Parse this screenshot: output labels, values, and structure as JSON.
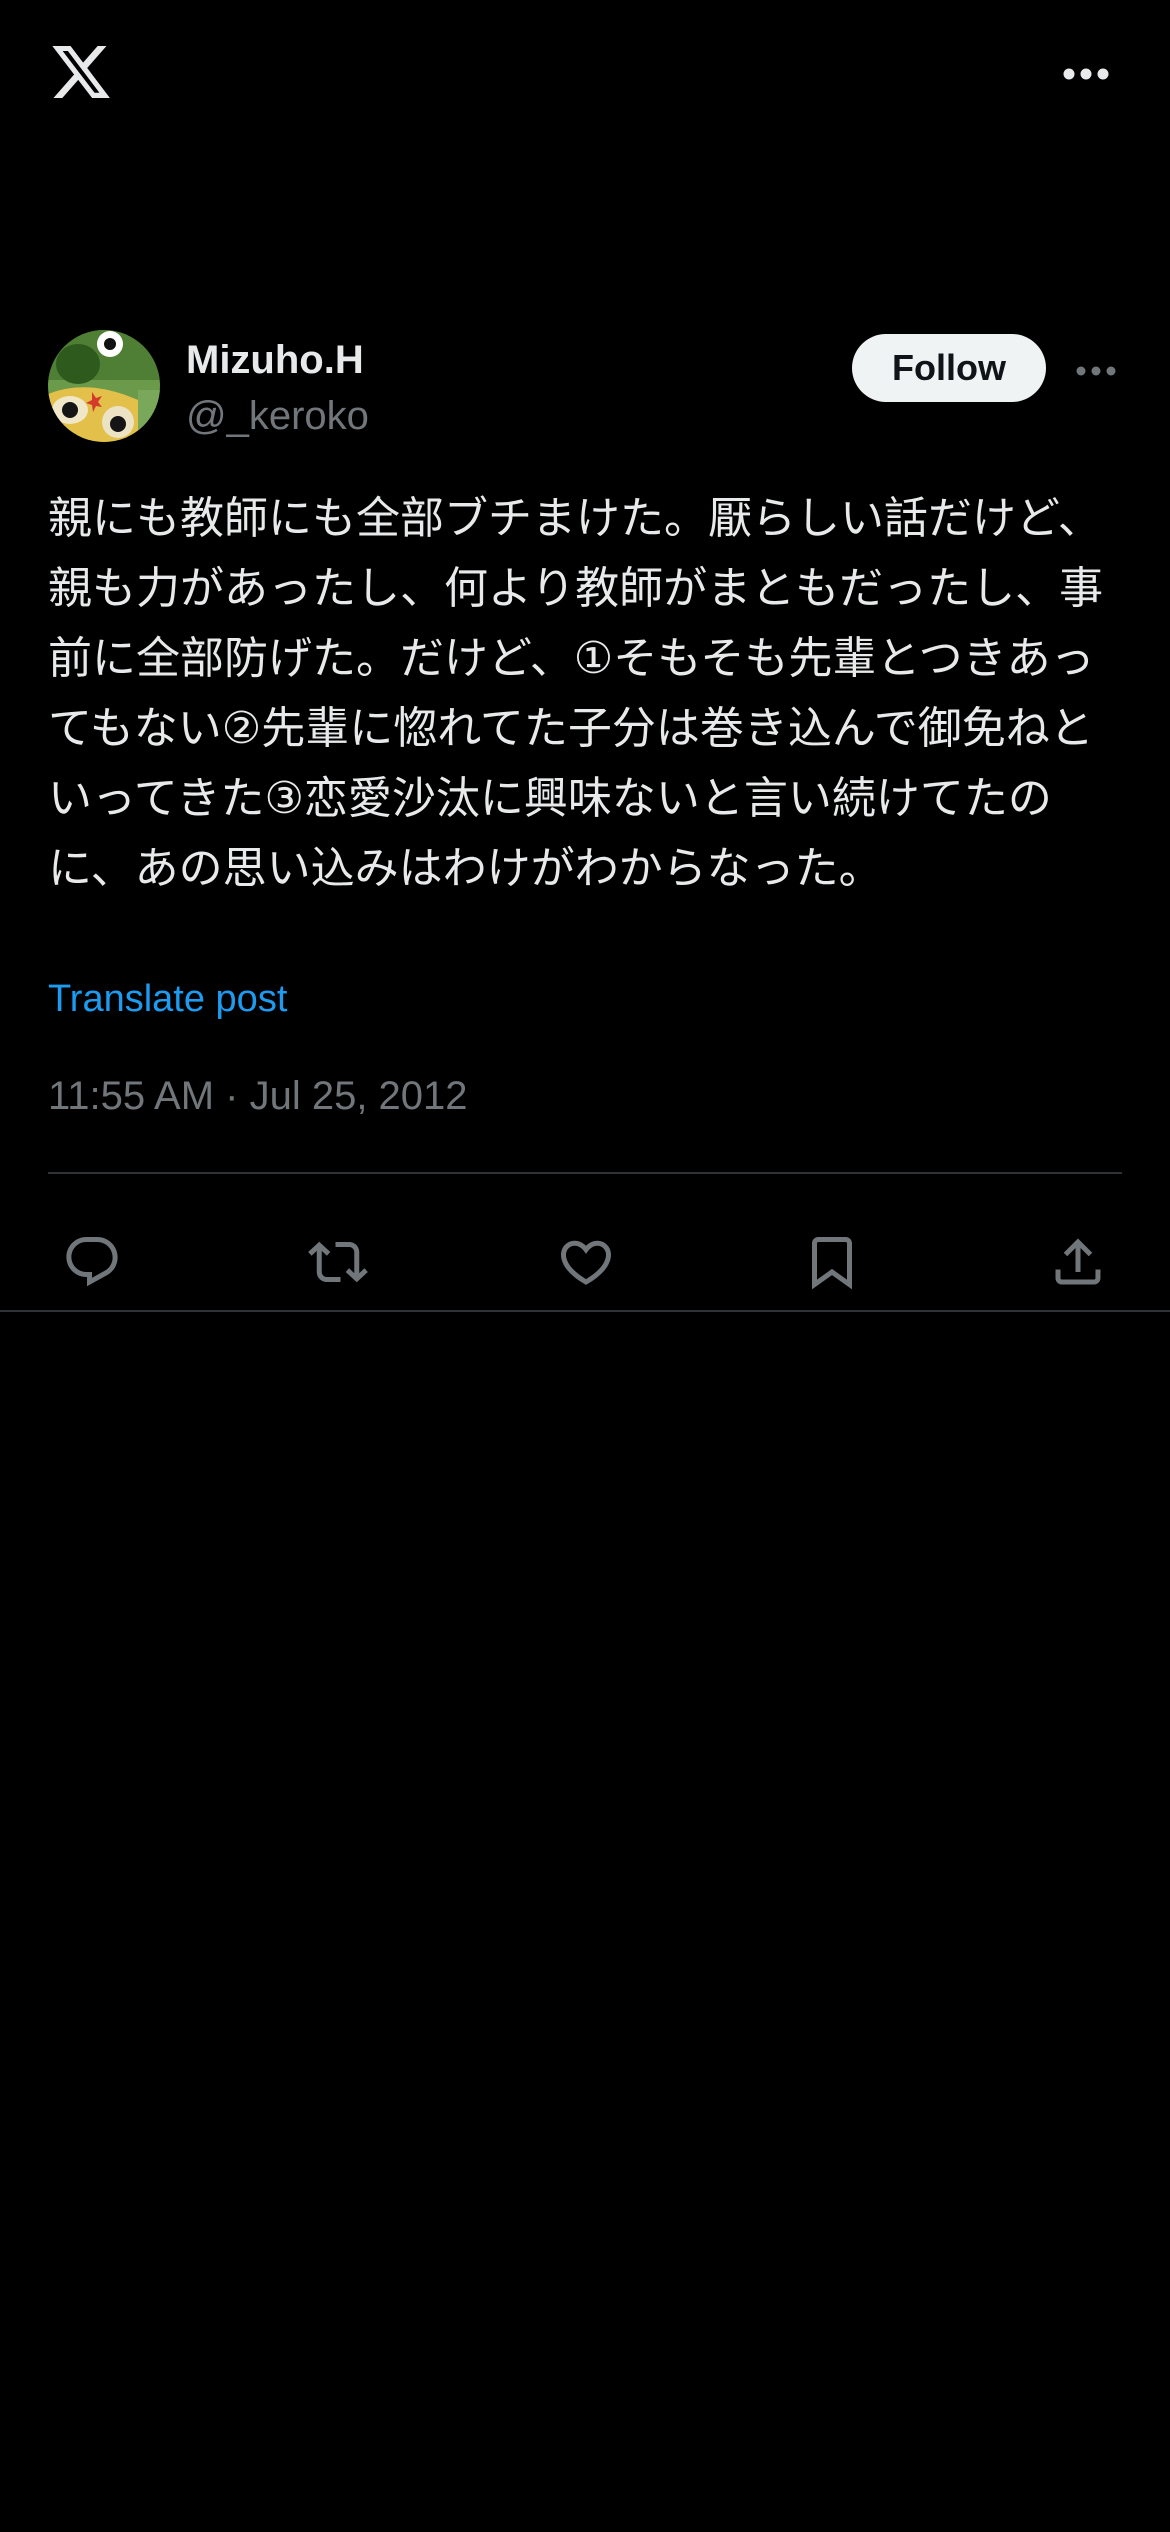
{
  "app": {
    "logo_icon": "x-logo-icon",
    "more_icon": "more-horizontal-icon"
  },
  "post": {
    "author": {
      "display_name": "Mizuho.H",
      "handle": "@_keroko"
    },
    "follow_label": "Follow",
    "text": "親にも教師にも全部ブチまけた。厭らしい話だけど、親も力があったし、何より教師がまともだったし、事前に全部防げた。だけど、①そもそも先輩とつきあってもない②先輩に惚れてた子分は巻き込んで御免ねといってきた③恋愛沙汰に興味ないと言い続けてたのに、あの思い込みはわけがわからなった。",
    "translate_label": "Translate post",
    "timestamp": "11:55 AM · Jul 25, 2012",
    "actions": [
      {
        "name": "reply",
        "icon": "reply-icon"
      },
      {
        "name": "repost",
        "icon": "repost-icon"
      },
      {
        "name": "like",
        "icon": "heart-icon"
      },
      {
        "name": "bookmark",
        "icon": "bookmark-icon"
      },
      {
        "name": "share",
        "icon": "share-icon"
      }
    ]
  },
  "colors": {
    "background": "#000000",
    "text": "#e7e9ea",
    "secondary": "#71767b",
    "link": "#1d9bf0",
    "divider": "#2f3336",
    "follow_bg": "#eff3f4"
  }
}
